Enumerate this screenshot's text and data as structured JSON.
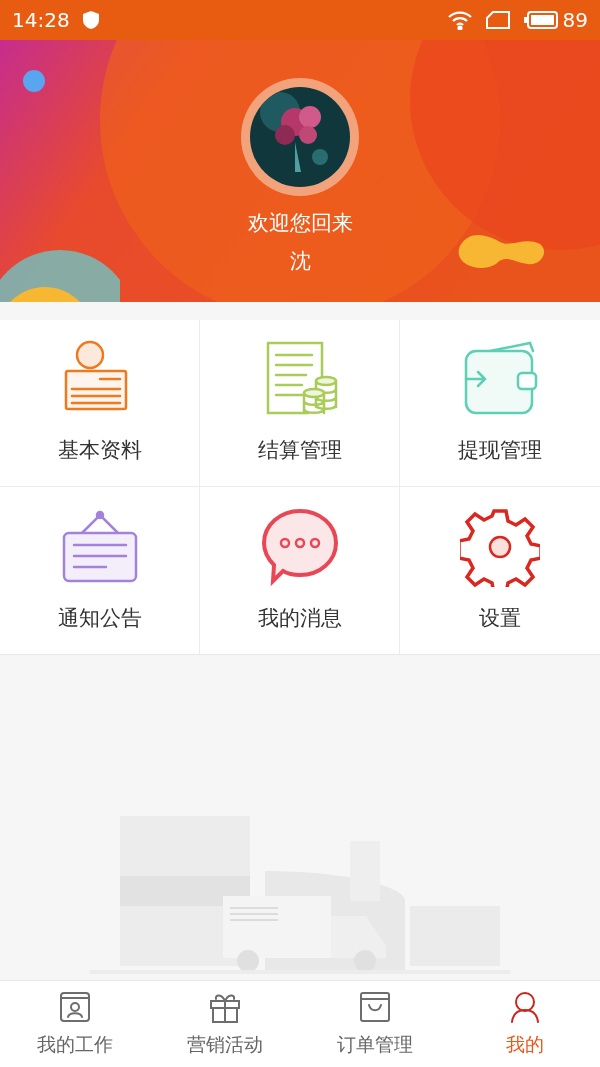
{
  "status_bar": {
    "time": "14:28",
    "battery": "89"
  },
  "profile": {
    "greeting": "欢迎您回来",
    "name": "沈"
  },
  "menu": [
    {
      "label": "基本资料",
      "kind": "profile"
    },
    {
      "label": "结算管理",
      "kind": "settlement"
    },
    {
      "label": "提现管理",
      "kind": "wallet"
    },
    {
      "label": "通知公告",
      "kind": "notice"
    },
    {
      "label": "我的消息",
      "kind": "message"
    },
    {
      "label": "设置",
      "kind": "settings"
    }
  ],
  "tabs": [
    {
      "label": "我的工作",
      "kind": "work",
      "selected": false
    },
    {
      "label": "营销活动",
      "kind": "gift",
      "selected": false
    },
    {
      "label": "订单管理",
      "kind": "order",
      "selected": false
    },
    {
      "label": "我的",
      "kind": "me",
      "selected": true
    }
  ]
}
